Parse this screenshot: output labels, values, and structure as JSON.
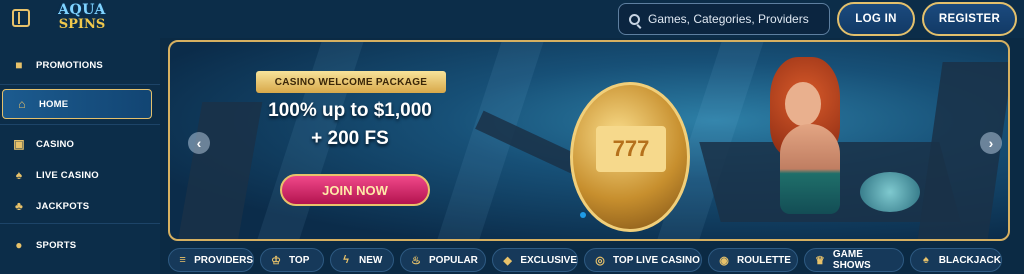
{
  "header": {
    "logo_line1": "AQUA",
    "logo_line2": "SPINS",
    "search_placeholder": "Games, Categories, Providers",
    "login_label": "LOG IN",
    "register_label": "REGISTER"
  },
  "sidebar": {
    "items": [
      {
        "label": "PROMOTIONS",
        "icon": "gift-icon"
      },
      {
        "label": "HOME",
        "icon": "home-icon",
        "active": true
      },
      {
        "label": "CASINO",
        "icon": "slot-machine-icon"
      },
      {
        "label": "LIVE CASINO",
        "icon": "cards-icon"
      },
      {
        "label": "JACKPOTS",
        "icon": "clover-icon"
      },
      {
        "label": "SPORTS",
        "icon": "ball-icon"
      }
    ]
  },
  "banner": {
    "ribbon": "CASINO WELCOME PACKAGE",
    "line1": "100% up to $1,000",
    "line2": "+ 200 FS",
    "cta_label": "JOIN NOW",
    "reels_text": "777",
    "prev_arrow": "‹",
    "next_arrow": "›"
  },
  "categories": [
    {
      "label": "PROVIDERS",
      "icon": "scroll-icon"
    },
    {
      "label": "TOP",
      "icon": "crown-icon"
    },
    {
      "label": "NEW",
      "icon": "lightning-icon"
    },
    {
      "label": "POPULAR",
      "icon": "torch-icon"
    },
    {
      "label": "EXCLUSIVE",
      "icon": "gem-icon"
    },
    {
      "label": "TOP LIVE CASINO",
      "icon": "chip-icon"
    },
    {
      "label": "ROULETTE",
      "icon": "roulette-icon"
    },
    {
      "label": "GAME SHOWS",
      "icon": "mic-icon"
    },
    {
      "label": "BLACKJACK",
      "icon": "cards-icon"
    }
  ],
  "colors": {
    "background": "#0b2a44",
    "accent_gold": "#e3c06c",
    "cta_pink": "#d8266a"
  }
}
